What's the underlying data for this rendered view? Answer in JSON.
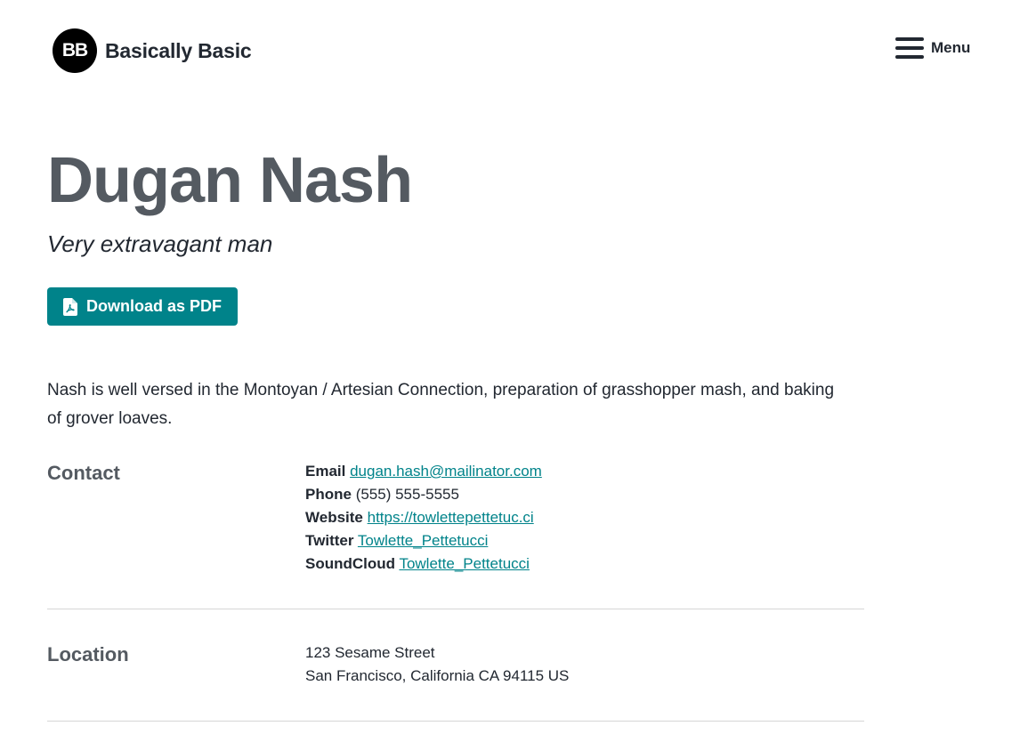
{
  "header": {
    "logo_text": "BB",
    "site_title": "Basically Basic",
    "menu_label": "Menu"
  },
  "main": {
    "title": "Dugan Nash",
    "subtitle": "Very extravagant man",
    "download_button": "Download as PDF",
    "intro": "Nash is well versed in the Montoyan / Artesian Connection, preparation of grasshopper mash, and baking of grover loaves."
  },
  "contact": {
    "heading": "Contact",
    "items": [
      {
        "label": "Email",
        "value": "dugan.hash@mailinator.com",
        "is_link": true
      },
      {
        "label": "Phone",
        "value": "(555) 555-5555",
        "is_link": false
      },
      {
        "label": "Website",
        "value": "https://towlettepettetuc.ci",
        "is_link": true
      },
      {
        "label": "Twitter",
        "value": "Towlette_Pettetucci",
        "is_link": true
      },
      {
        "label": "SoundCloud",
        "value": "Towlette_Pettetucci",
        "is_link": true
      }
    ]
  },
  "location": {
    "heading": "Location",
    "line1": "123 Sesame Street",
    "line2": "San Francisco, California CA 94115 US"
  },
  "colors": {
    "accent": "#00838a",
    "heading": "#545a61",
    "text": "#222831"
  },
  "icons": {
    "pdf": "file-pdf-icon",
    "menu": "hamburger-menu-icon"
  }
}
